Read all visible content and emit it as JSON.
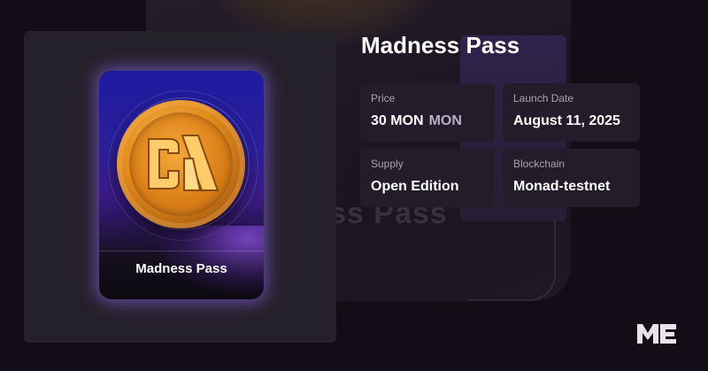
{
  "collection": {
    "title": "Madness Pass",
    "card_title": "Madness Pass",
    "background_text": "ss Pass"
  },
  "details": {
    "price": {
      "label": "Price",
      "value": "30 MON",
      "unit": "MON"
    },
    "launch_date": {
      "label": "Launch Date",
      "value": "August 11, 2025"
    },
    "supply": {
      "label": "Supply",
      "value": "Open Edition"
    },
    "blockchain": {
      "label": "Blockchain",
      "value": "Monad-testnet"
    }
  },
  "icons": {
    "coin": "madness-coin-icon",
    "brand": "magic-eden-logo-icon"
  },
  "colors": {
    "background": "#120d16",
    "panel": "#25212b",
    "info_box": "#231d2b",
    "coin_orange": "#e08a1c",
    "card_glow": "#9a6eff"
  }
}
